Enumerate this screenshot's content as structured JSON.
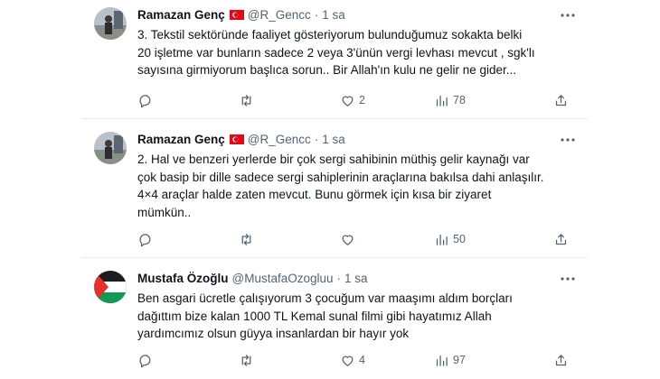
{
  "tweets": [
    {
      "name": "Ramazan Genç",
      "handle": "@R_Gencc",
      "dot": "·",
      "time": "1 sa",
      "has_flag": true,
      "text": "3. Tekstil sektöründe faaliyet gösteriyorum bulunduğumuz sokakta belki\n20 işletme var bunların sadece 2 veya 3'ünün vergi levhası mevcut , sgk'lı\nsayısına girmiyorum başlıca sorun.. Bir Allah'ın kulu ne gelir ne gider...",
      "reply_count": "",
      "retweet_count": "",
      "like_count": "2",
      "view_count": "78"
    },
    {
      "name": "Ramazan Genç",
      "handle": "@R_Gencc",
      "dot": "·",
      "time": "1 sa",
      "has_flag": true,
      "text": "2. Hal ve benzeri yerlerde bir çok sergi sahibinin müthiş gelir kaynağı var\nçok basip bir dille sadece sergi sahiplerinin araçlarına bakılsa dahi anlaşılır.\n4×4 araçlar halde zaten mevcut. Bunu görmek için kısa bir ziyaret\nmümkün..",
      "reply_count": "",
      "retweet_count": "",
      "like_count": "",
      "view_count": "50"
    },
    {
      "name": "Mustafa Özoğlu",
      "handle": "@MustafaOzogluu",
      "dot": "·",
      "time": "1 sa",
      "has_flag": false,
      "text": "Ben asgari ücretle çalışıyorum 3 çocuğum var maaşımı aldım borçları\ndağıttım bize kalan 1000 TL Kemal sunal filmi gibi hayatımız Allah\nyardımcımız olsun güyya insanlardan bir hayır yok",
      "reply_count": "",
      "retweet_count": "",
      "like_count": "4",
      "view_count": "97"
    }
  ],
  "icons": {
    "reply": "reply-icon",
    "retweet": "retweet-icon",
    "like": "like-icon",
    "views": "views-icon",
    "share": "share-icon",
    "more": "more-icon"
  },
  "colors": {
    "text": "#0f1419",
    "secondary": "#536471",
    "divider": "#e6ecf0",
    "flag_red": "#e30a17"
  }
}
